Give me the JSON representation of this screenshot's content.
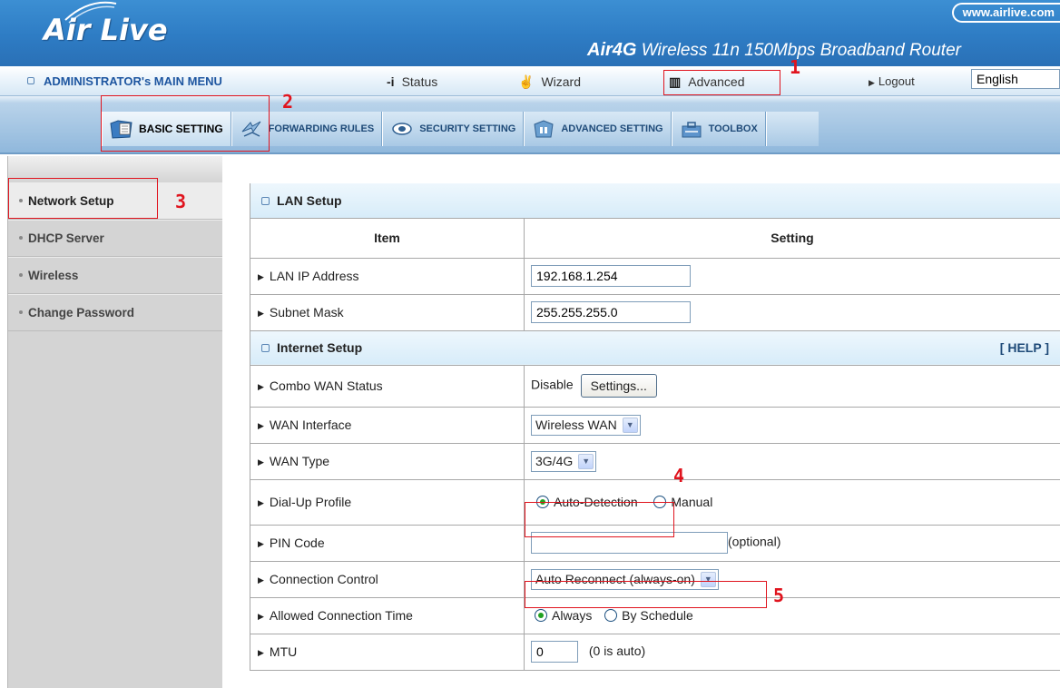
{
  "header": {
    "logo": "Air Live",
    "url": "www.airlive.com",
    "product_model": "Air4G",
    "product_desc": "Wireless 11n 150Mbps Broadband Router"
  },
  "menubar": {
    "admin_menu": "ADMINISTRATOR's MAIN MENU",
    "status": "Status",
    "wizard": "Wizard",
    "advanced": "Advanced",
    "logout": "Logout",
    "language": "English"
  },
  "tabs": [
    {
      "label": "BASIC SETTING",
      "icon": "folder-document-icon"
    },
    {
      "label": "FORWARDING RULES",
      "icon": "forward-arrows-icon"
    },
    {
      "label": "SECURITY SETTING",
      "icon": "eye-security-icon"
    },
    {
      "label": "ADVANCED SETTING",
      "icon": "building-icon"
    },
    {
      "label": "TOOLBOX",
      "icon": "toolbox-icon"
    }
  ],
  "sidebar": {
    "items": [
      {
        "label": "Network Setup"
      },
      {
        "label": "DHCP Server"
      },
      {
        "label": "Wireless"
      },
      {
        "label": "Change Password"
      }
    ]
  },
  "lan": {
    "title": "LAN Setup",
    "col_item": "Item",
    "col_setting": "Setting",
    "ip_label": "LAN IP Address",
    "ip_value": "192.168.1.254",
    "mask_label": "Subnet Mask",
    "mask_value": "255.255.255.0"
  },
  "internet": {
    "title": "Internet Setup",
    "help": "[ HELP ]",
    "combo_label": "Combo WAN Status",
    "combo_value": "Disable",
    "settings_btn": "Settings...",
    "wan_iface_label": "WAN Interface",
    "wan_iface_value": "Wireless WAN",
    "wan_type_label": "WAN Type",
    "wan_type_value": "3G/4G",
    "dialup_label": "Dial-Up Profile",
    "dialup_auto": "Auto-Detection",
    "dialup_manual": "Manual",
    "pin_label": "PIN Code",
    "pin_value": "",
    "pin_note": "(optional)",
    "conn_label": "Connection Control",
    "conn_value": "Auto Reconnect (always-on)",
    "allowed_label": "Allowed Connection Time",
    "allowed_always": "Always",
    "allowed_schedule": "By Schedule",
    "mtu_label": "MTU",
    "mtu_value": "0",
    "mtu_note": "(0 is auto)"
  },
  "annotations": [
    "1",
    "2",
    "3",
    "4",
    "5"
  ],
  "colors": {
    "annotation": "#e0141e",
    "banner": "#2e7cc4",
    "section_text": "#1e4a78"
  }
}
